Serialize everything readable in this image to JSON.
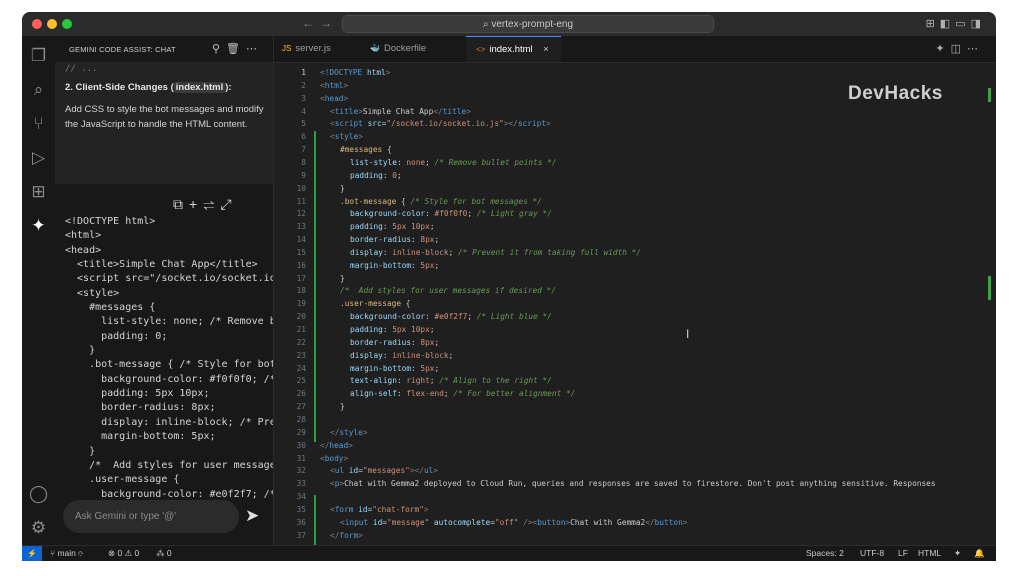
{
  "window": {
    "search_text": "vertex-prompt-eng",
    "watermark": "DevHacks"
  },
  "chat_panel": {
    "title": "GEMINI CODE ASSIST: CHAT",
    "leftover_code": "// ...",
    "heading_prefix": "2. Client-Side Changes (",
    "heading_file": "index.html",
    "heading_suffix": "):",
    "description": "Add CSS to style the bot messages and modify the JavaScript to handle the HTML content.",
    "code_lines": [
      "<!DOCTYPE html>",
      "<html>",
      "<head>",
      "  <title>Simple Chat App</title>",
      "  <script src=\"/socket.io/socket.io",
      "  <style>",
      "    #messages {",
      "      list-style: none; /* Remove b",
      "      padding: 0;",
      "    }",
      "    .bot-message { /* Style for bot",
      "      background-color: #f0f0f0; /*",
      "      padding: 5px 10px;",
      "      border-radius: 8px;",
      "      display: inline-block; /* Pre",
      "      margin-bottom: 5px;",
      "    }",
      "    /*  Add styles for user message",
      "    .user-message {",
      "      background-color: #e0f2f7; /*"
    ],
    "input_placeholder": "Ask Gemini or type '@'"
  },
  "tabs": [
    {
      "icon": "JS",
      "label": "server.js",
      "active": false
    },
    {
      "icon": "docker",
      "label": "Dockerfile",
      "active": false
    },
    {
      "icon": "<>",
      "label": "index.html",
      "active": true
    }
  ],
  "editor": {
    "current_line": 1,
    "lines": [
      {
        "n": 1,
        "indent": 0,
        "parts": [
          [
            "pu",
            "<!"
          ],
          [
            "t",
            "DOCTYPE "
          ],
          [
            "a",
            "html"
          ],
          [
            "pu",
            ">"
          ]
        ]
      },
      {
        "n": 2,
        "indent": 0,
        "parts": [
          [
            "pu",
            "<"
          ],
          [
            "t",
            "html"
          ],
          [
            "pu",
            ">"
          ]
        ]
      },
      {
        "n": 3,
        "indent": 0,
        "parts": [
          [
            "pu",
            "<"
          ],
          [
            "t",
            "head"
          ],
          [
            "pu",
            ">"
          ]
        ]
      },
      {
        "n": 4,
        "indent": 1,
        "parts": [
          [
            "pu",
            "<"
          ],
          [
            "t",
            "title"
          ],
          [
            "pu",
            ">"
          ],
          [
            "x",
            "Simple Chat App"
          ],
          [
            "pu",
            "</"
          ],
          [
            "t",
            "title"
          ],
          [
            "pu",
            ">"
          ]
        ]
      },
      {
        "n": 5,
        "indent": 1,
        "parts": [
          [
            "pu",
            "<"
          ],
          [
            "t",
            "script "
          ],
          [
            "a",
            "src"
          ],
          [
            "x",
            "="
          ],
          [
            "s",
            "\"/socket.io/socket.io.js\""
          ],
          [
            "pu",
            "></"
          ],
          [
            "t",
            "script"
          ],
          [
            "pu",
            ">"
          ]
        ]
      },
      {
        "n": 6,
        "indent": 1,
        "parts": [
          [
            "pu",
            "<"
          ],
          [
            "t",
            "style"
          ],
          [
            "pu",
            ">"
          ]
        ]
      },
      {
        "n": 7,
        "indent": 2,
        "parts": [
          [
            "sel",
            "#messages "
          ],
          [
            "x",
            "{"
          ]
        ]
      },
      {
        "n": 8,
        "indent": 3,
        "parts": [
          [
            "p",
            "list-style"
          ],
          [
            "x",
            ": "
          ],
          [
            "v",
            "none"
          ],
          [
            "x",
            "; "
          ],
          [
            "c",
            "/* Remove bullet points */"
          ]
        ]
      },
      {
        "n": 9,
        "indent": 3,
        "parts": [
          [
            "p",
            "padding"
          ],
          [
            "x",
            ": "
          ],
          [
            "v",
            "0"
          ],
          [
            "x",
            ";"
          ]
        ]
      },
      {
        "n": 10,
        "indent": 2,
        "parts": [
          [
            "x",
            "}"
          ]
        ]
      },
      {
        "n": 11,
        "indent": 2,
        "parts": [
          [
            "sel",
            ".bot-message "
          ],
          [
            "x",
            "{ "
          ],
          [
            "c",
            "/* Style for bot messages */"
          ]
        ]
      },
      {
        "n": 12,
        "indent": 3,
        "parts": [
          [
            "p",
            "background-color"
          ],
          [
            "x",
            ": "
          ],
          [
            "v",
            "#f0f0f0"
          ],
          [
            "x",
            "; "
          ],
          [
            "c",
            "/* Light gray */"
          ]
        ]
      },
      {
        "n": 13,
        "indent": 3,
        "parts": [
          [
            "p",
            "padding"
          ],
          [
            "x",
            ": "
          ],
          [
            "v",
            "5px 10px"
          ],
          [
            "x",
            ";"
          ]
        ]
      },
      {
        "n": 14,
        "indent": 3,
        "parts": [
          [
            "p",
            "border-radius"
          ],
          [
            "x",
            ": "
          ],
          [
            "v",
            "8px"
          ],
          [
            "x",
            ";"
          ]
        ]
      },
      {
        "n": 15,
        "indent": 3,
        "parts": [
          [
            "p",
            "display"
          ],
          [
            "x",
            ": "
          ],
          [
            "v",
            "inline-block"
          ],
          [
            "x",
            "; "
          ],
          [
            "c",
            "/* Prevent it from taking full width */"
          ]
        ]
      },
      {
        "n": 16,
        "indent": 3,
        "parts": [
          [
            "p",
            "margin-bottom"
          ],
          [
            "x",
            ": "
          ],
          [
            "v",
            "5px"
          ],
          [
            "x",
            ";"
          ]
        ]
      },
      {
        "n": 17,
        "indent": 2,
        "parts": [
          [
            "x",
            "}"
          ]
        ]
      },
      {
        "n": 18,
        "indent": 2,
        "parts": [
          [
            "c",
            "/*  Add styles for user messages if desired */"
          ]
        ]
      },
      {
        "n": 19,
        "indent": 2,
        "parts": [
          [
            "sel",
            ".user-message "
          ],
          [
            "x",
            "{"
          ]
        ]
      },
      {
        "n": 20,
        "indent": 3,
        "parts": [
          [
            "p",
            "background-color"
          ],
          [
            "x",
            ": "
          ],
          [
            "v",
            "#e0f2f7"
          ],
          [
            "x",
            "; "
          ],
          [
            "c",
            "/* Light blue */"
          ]
        ]
      },
      {
        "n": 21,
        "indent": 3,
        "parts": [
          [
            "p",
            "padding"
          ],
          [
            "x",
            ": "
          ],
          [
            "v",
            "5px 10px"
          ],
          [
            "x",
            ";"
          ]
        ]
      },
      {
        "n": 22,
        "indent": 3,
        "parts": [
          [
            "p",
            "border-radius"
          ],
          [
            "x",
            ": "
          ],
          [
            "v",
            "8px"
          ],
          [
            "x",
            ";"
          ]
        ]
      },
      {
        "n": 23,
        "indent": 3,
        "parts": [
          [
            "p",
            "display"
          ],
          [
            "x",
            ": "
          ],
          [
            "v",
            "inline-block"
          ],
          [
            "x",
            ";"
          ]
        ]
      },
      {
        "n": 24,
        "indent": 3,
        "parts": [
          [
            "p",
            "margin-bottom"
          ],
          [
            "x",
            ": "
          ],
          [
            "v",
            "5px"
          ],
          [
            "x",
            ";"
          ]
        ]
      },
      {
        "n": 25,
        "indent": 3,
        "parts": [
          [
            "p",
            "text-align"
          ],
          [
            "x",
            ": "
          ],
          [
            "v",
            "right"
          ],
          [
            "x",
            "; "
          ],
          [
            "c",
            "/* Align to the right */"
          ]
        ]
      },
      {
        "n": 26,
        "indent": 3,
        "parts": [
          [
            "p",
            "align-self"
          ],
          [
            "x",
            ": "
          ],
          [
            "v",
            "flex-end"
          ],
          [
            "x",
            "; "
          ],
          [
            "c",
            "/* For better alignment */"
          ]
        ]
      },
      {
        "n": 27,
        "indent": 2,
        "parts": [
          [
            "x",
            "}"
          ]
        ]
      },
      {
        "n": 28,
        "indent": 0,
        "parts": []
      },
      {
        "n": 29,
        "indent": 1,
        "parts": [
          [
            "pu",
            "</"
          ],
          [
            "t",
            "style"
          ],
          [
            "pu",
            ">"
          ]
        ]
      },
      {
        "n": 30,
        "indent": 0,
        "parts": [
          [
            "pu",
            "</"
          ],
          [
            "t",
            "head"
          ],
          [
            "pu",
            ">"
          ]
        ]
      },
      {
        "n": 31,
        "indent": 0,
        "parts": [
          [
            "pu",
            "<"
          ],
          [
            "t",
            "body"
          ],
          [
            "pu",
            ">"
          ]
        ]
      },
      {
        "n": 32,
        "indent": 1,
        "parts": [
          [
            "pu",
            "<"
          ],
          [
            "t",
            "ul "
          ],
          [
            "a",
            "id"
          ],
          [
            "x",
            "="
          ],
          [
            "s",
            "\"messages\""
          ],
          [
            "pu",
            "></"
          ],
          [
            "t",
            "ul"
          ],
          [
            "pu",
            ">"
          ]
        ]
      },
      {
        "n": 33,
        "indent": 1,
        "parts": [
          [
            "pu",
            "<"
          ],
          [
            "t",
            "p"
          ],
          [
            "pu",
            ">"
          ],
          [
            "x",
            "Chat with Gemma2 deployed to Cloud Run, queries and responses are saved to firestore. Don't post anything sensitive. Responses"
          ]
        ]
      },
      {
        "n": 34,
        "indent": 0,
        "parts": []
      },
      {
        "n": 35,
        "indent": 1,
        "parts": [
          [
            "pu",
            "<"
          ],
          [
            "t",
            "form "
          ],
          [
            "a",
            "id"
          ],
          [
            "x",
            "="
          ],
          [
            "s",
            "\"chat-form\""
          ],
          [
            "pu",
            ">"
          ]
        ]
      },
      {
        "n": 36,
        "indent": 2,
        "parts": [
          [
            "pu",
            "<"
          ],
          [
            "t",
            "input "
          ],
          [
            "a",
            "id"
          ],
          [
            "x",
            "="
          ],
          [
            "s",
            "\"message\" "
          ],
          [
            "a",
            "autocomplete"
          ],
          [
            "x",
            "="
          ],
          [
            "s",
            "\"off\" "
          ],
          [
            "pu",
            "/><"
          ],
          [
            "t",
            "button"
          ],
          [
            "pu",
            ">"
          ],
          [
            "x",
            "Chat with Gemma2"
          ],
          [
            "pu",
            "</"
          ],
          [
            "t",
            "button"
          ],
          [
            "pu",
            ">"
          ]
        ]
      },
      {
        "n": 37,
        "indent": 1,
        "parts": [
          [
            "pu",
            "</"
          ],
          [
            "t",
            "form"
          ],
          [
            "pu",
            ">"
          ]
        ]
      }
    ]
  },
  "status_bar": {
    "branch": "main",
    "problems": "⊗ 0 ⚠ 0",
    "ports": "⁂ 0",
    "spaces": "Spaces: 2",
    "encoding": "UTF-8",
    "eol": "LF",
    "language": "HTML"
  },
  "colors": {
    "accent": "#0e63ce",
    "git_added": "#2ea043"
  }
}
